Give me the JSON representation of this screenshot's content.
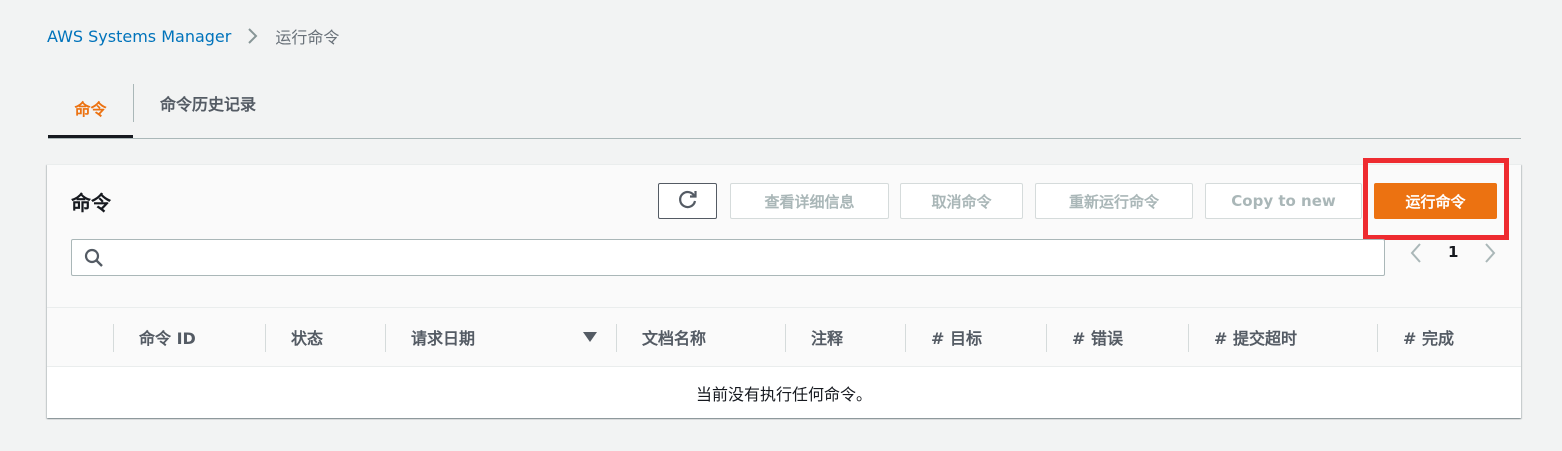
{
  "breadcrumb": {
    "root": "AWS Systems Manager",
    "current": "运行命令"
  },
  "tabs": [
    {
      "label": "命令",
      "active": true
    },
    {
      "label": "命令历史记录",
      "active": false
    }
  ],
  "panel": {
    "title": "命令",
    "buttons": {
      "refresh_icon": "refresh-icon",
      "view_details": "查看详细信息",
      "cancel": "取消命令",
      "rerun": "重新运行命令",
      "copy_to_new": "Copy to new",
      "run": "运行命令"
    },
    "search": {
      "placeholder": "",
      "value": ""
    },
    "pagination": {
      "current_page": "1"
    },
    "table": {
      "columns": [
        "命令 ID",
        "状态",
        "请求日期",
        "文档名称",
        "注释",
        "# 目标",
        "# 错误",
        "# 提交超时",
        "# 完成"
      ],
      "sort_column": "请求日期",
      "empty_message": "当前没有执行任何命令。"
    }
  },
  "colors": {
    "accent": "#ec7211",
    "link": "#0073bb",
    "highlight_box": "#ee2b30"
  }
}
